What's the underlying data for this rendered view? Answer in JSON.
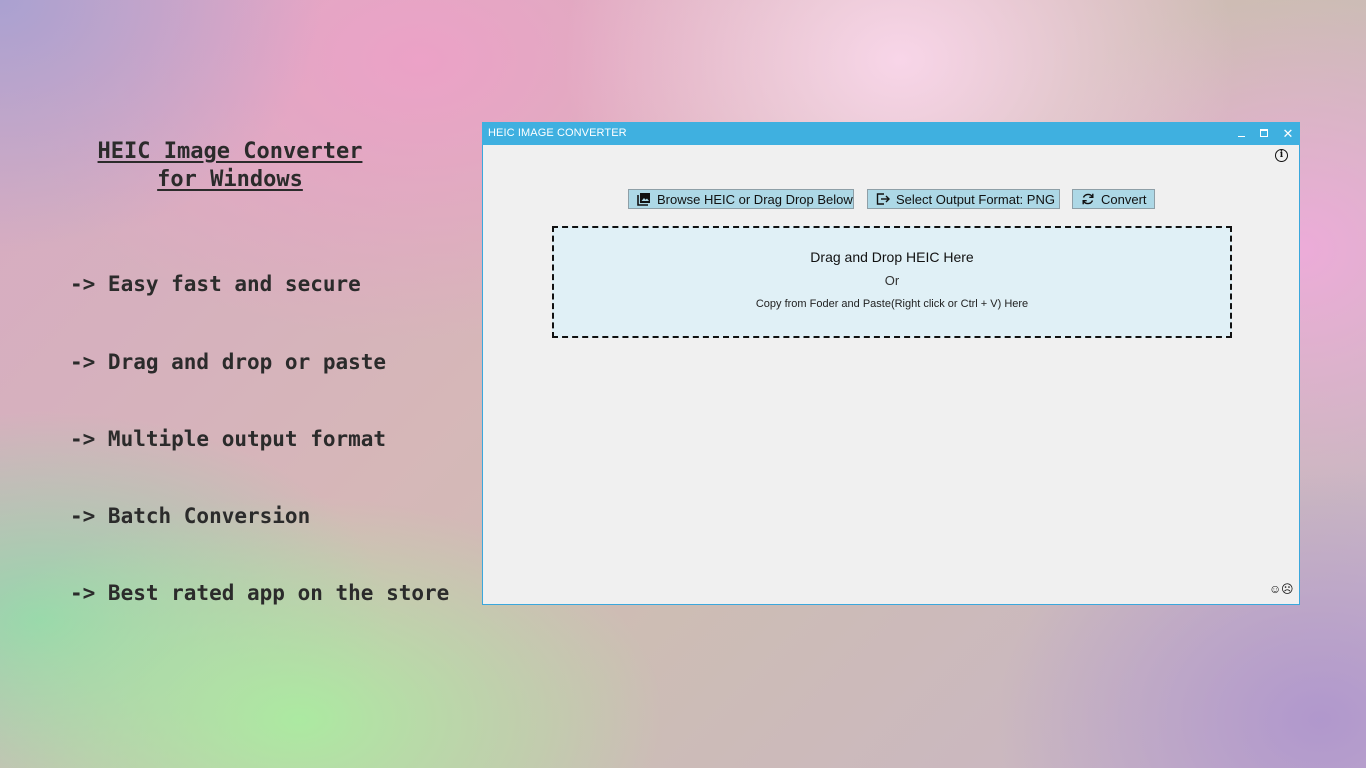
{
  "promo": {
    "title_line1": "HEIC Image Converter",
    "title_line2": "for Windows",
    "features": [
      "-> Easy fast and secure",
      "-> Drag and drop or paste",
      "-> Multiple output format",
      "-> Batch Conversion",
      "-> Best rated app on the store"
    ]
  },
  "window": {
    "title": "HEIC IMAGE CONVERTER",
    "controls": {
      "close": "✕"
    },
    "toolbar": {
      "browse_label": "Browse HEIC or Drag Drop Below",
      "format_label": "Select Output Format: PNG",
      "convert_label": "Convert"
    },
    "dropzone": {
      "heading": "Drag and Drop HEIC Here",
      "or": "Or",
      "paste_hint": "Copy from Foder and Paste(Right click or Ctrl + V) Here"
    },
    "feedback": {
      "happy": "☺",
      "sad": "☹"
    }
  },
  "colors": {
    "titlebar": "#3fb0e0",
    "button_bg": "#add8e6",
    "dropzone_bg": "#e0f0f6",
    "window_bg": "#f0f0f0"
  },
  "icons": {
    "browse": "image-stack-icon",
    "format": "export-icon",
    "convert": "refresh-icon",
    "info": "info-icon"
  }
}
